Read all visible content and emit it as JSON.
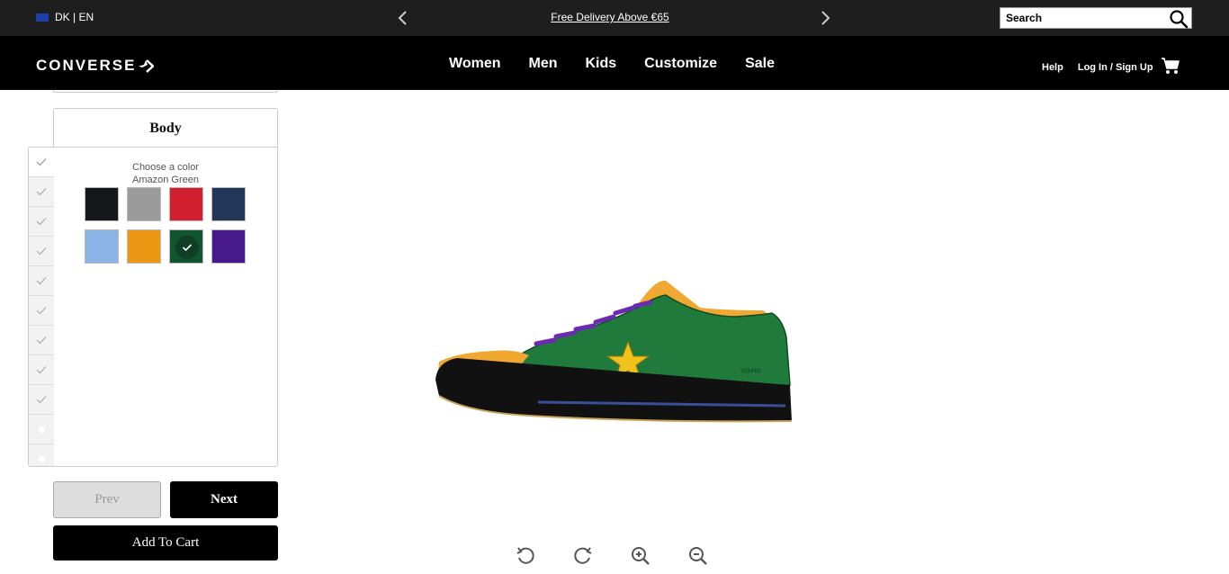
{
  "topbar": {
    "locale": "DK | EN",
    "promo": "Free Delivery Above €65",
    "search_placeholder": "Search"
  },
  "nav": {
    "logo": "CONVERSE",
    "links": [
      "Women",
      "Men",
      "Kids",
      "Customize",
      "Sale"
    ],
    "help": "Help",
    "login": "Log In / Sign Up"
  },
  "customizer": {
    "section_title": "Body",
    "choose_label": "Choose a color",
    "selected_color": "Amazon Green",
    "swatches": [
      {
        "name": "Black",
        "hex": "#16171a"
      },
      {
        "name": "Grey",
        "hex": "#9b9b9b"
      },
      {
        "name": "Red",
        "hex": "#d11f30"
      },
      {
        "name": "Navy",
        "hex": "#233759"
      },
      {
        "name": "Light Blue",
        "hex": "#8ab4e5"
      },
      {
        "name": "Orange",
        "hex": "#ec9815"
      },
      {
        "name": "Amazon Green",
        "hex": "#0f5630",
        "selected": true
      },
      {
        "name": "Purple",
        "hex": "#48198a"
      }
    ],
    "steps_completed": 9,
    "steps_total": 11
  },
  "buttons": {
    "prev": "Prev",
    "next": "Next",
    "add_to_cart": "Add To Cart"
  },
  "shoe": {
    "body_color": "#1f7a3c",
    "toe_color": "#f0a830",
    "sole_color": "#111111",
    "lace_color": "#6a2bb0",
    "star_color": "#f1c21b",
    "heel_text": "YOURO"
  },
  "colors": {
    "topbar_bg": "#1e1e1e",
    "nav_bg": "#000000",
    "accent": "#000000"
  }
}
